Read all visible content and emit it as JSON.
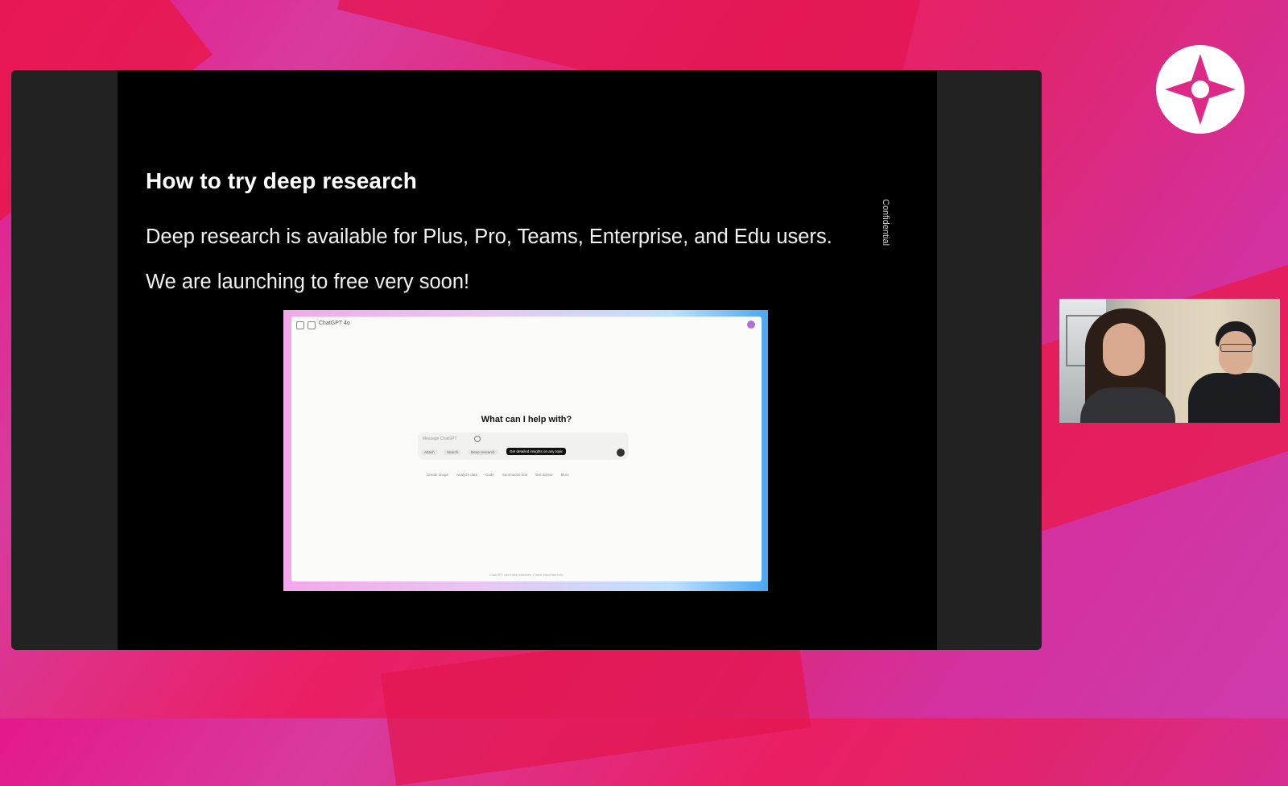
{
  "slide": {
    "title": "How to try deep research",
    "line1": "Deep research is available for Plus, Pro, Teams, Enterprise, and Edu users.",
    "line2": "We are launching to free very soon!",
    "confidential": "Confidential"
  },
  "screenshot": {
    "model_label": "ChatGPT 4o",
    "heading": "What can I help with?",
    "composer_placeholder": "Message ChatGPT",
    "chips": [
      "Attach",
      "Search",
      "Deep research"
    ],
    "tooltip": "Get detailed insights on any topic",
    "suggestions": [
      "Create image",
      "Analyze data",
      "Code",
      "Summarize text",
      "Get advice",
      "More"
    ],
    "footer": "ChatGPT can make mistakes. Check important info."
  },
  "colors": {
    "background": "#d83b9e",
    "accent": "#e8174b",
    "slide_bg": "#000000",
    "stage_bg": "#222222"
  },
  "icons": {
    "logo": "star-circle-logo-icon"
  }
}
